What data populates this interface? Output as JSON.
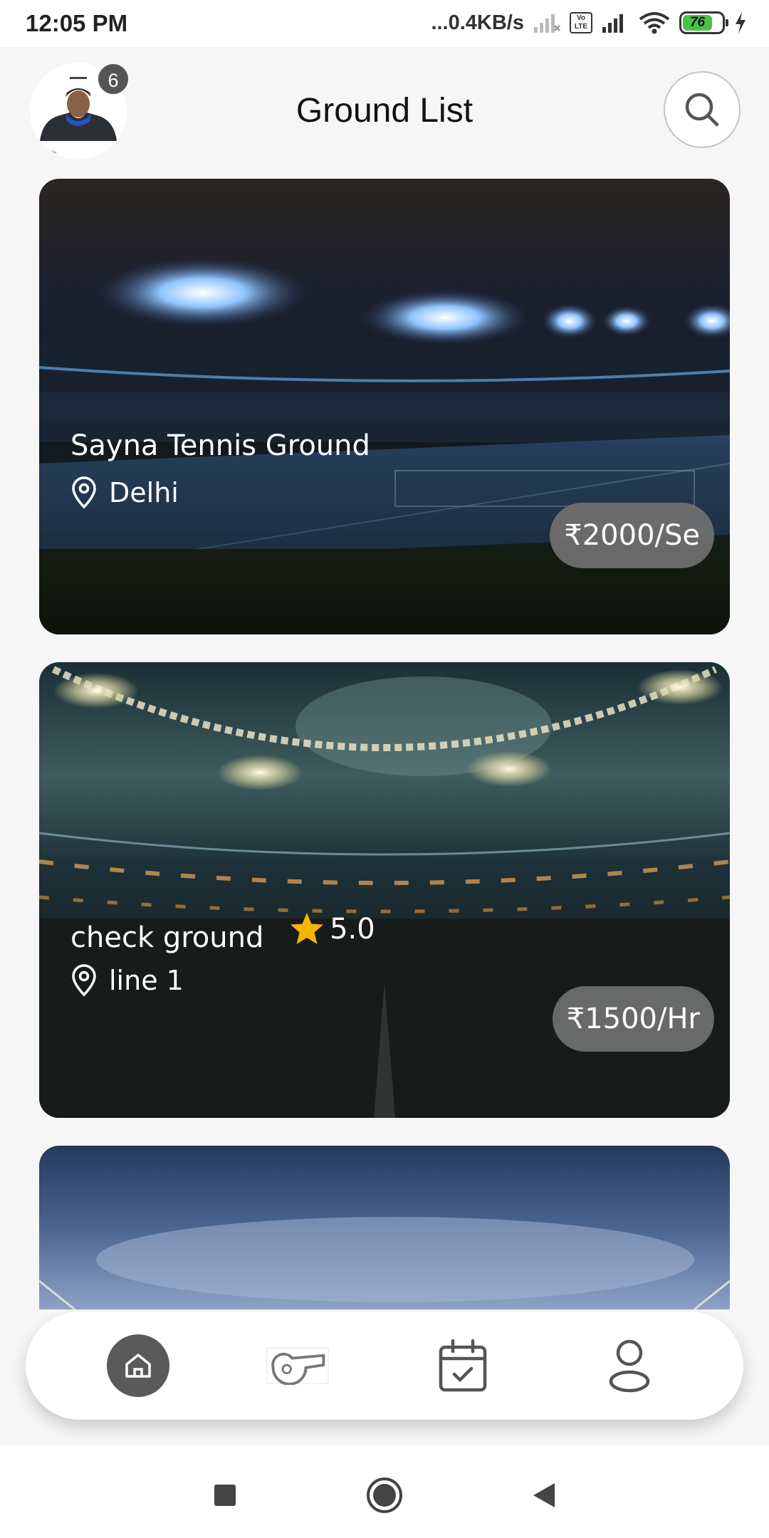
{
  "status_bar": {
    "time": "12:05 PM",
    "net_speed": "...0.4KB/s",
    "volte_label": "Vo LTE",
    "battery": "76",
    "battery_level": 0.76
  },
  "header": {
    "title": "Ground List",
    "notification_count": "6",
    "avatar_caption": "Hoodie"
  },
  "grounds": [
    {
      "name": "Sayna Tennis Ground",
      "location": "Delhi",
      "price": "₹2000/Se",
      "rating": ""
    },
    {
      "name": "check ground",
      "location": "line 1",
      "price": "₹1500/Hr",
      "rating": "5.0"
    }
  ],
  "nav": {
    "items": [
      "home-icon",
      "whistle-icon",
      "calendar-icon",
      "profile-icon"
    ],
    "active": "home"
  },
  "colors": {
    "nav_active": "#5a5a5a",
    "star": "#f5b400",
    "price_pill": "#707070"
  }
}
